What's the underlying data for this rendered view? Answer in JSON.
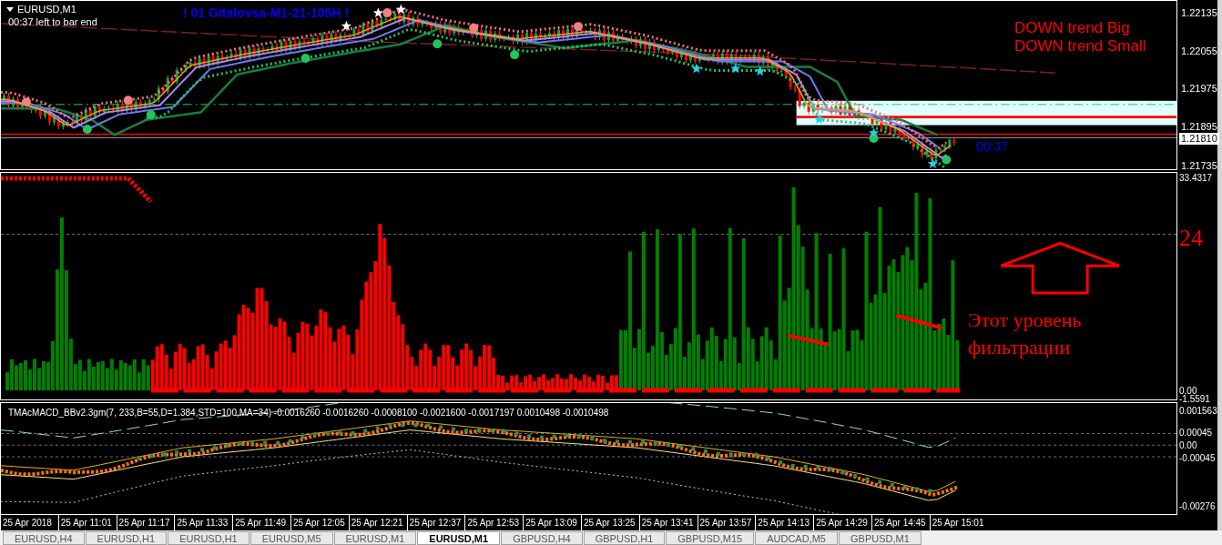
{
  "price_chart": {
    "symbol": "EURUSD,M1",
    "timer": "00:37 left to bar end",
    "banner": "! 01 Gitalovsa-M1-21-105H !",
    "trend_labels": [
      "DOWN trend Big",
      "DOWN trend Small"
    ],
    "countdown": "00:37",
    "axis": [
      {
        "label": "1.22135",
        "current": false
      },
      {
        "label": "1.22055",
        "current": false
      },
      {
        "label": "1.21975",
        "current": false
      },
      {
        "label": "1.21895",
        "current": false
      },
      {
        "label": "1.21810",
        "current": true
      },
      {
        "label": "1.21735",
        "current": false
      }
    ]
  },
  "histogram_panel": {
    "level_label": "24",
    "note": "Этот уровень фильтрации",
    "axis": [
      "33.4317",
      "0.00",
      "-1.5591"
    ]
  },
  "macd_panel": {
    "title": "TMAcMACD_BBv2.3gm(7, 233,B=55,D=1.384,STD=100,MA=34) -0.0016260 -0.0016260 -0.0008100 -0.0021600 -0.0017197 0.0010498 -0.0010498",
    "axis": [
      "0.001563",
      "0.00045",
      "0.00",
      "-0.00045",
      "-0.00276"
    ]
  },
  "time_axis": [
    "25 Apr 2018",
    "25 Apr 11:01",
    "25 Apr 11:17",
    "25 Apr 11:33",
    "25 Apr 11:49",
    "25 Apr 12:05",
    "25 Apr 12:21",
    "25 Apr 12:37",
    "25 Apr 12:53",
    "25 Apr 13:09",
    "25 Apr 13:25",
    "25 Apr 13:41",
    "25 Apr 13:57",
    "25 Apr 14:13",
    "25 Apr 14:29",
    "25 Apr 14:45",
    "25 Apr 15:01"
  ],
  "tabs": [
    {
      "label": "EURUSD,H4",
      "selected": false
    },
    {
      "label": "EURUSD,H1",
      "selected": false
    },
    {
      "label": "EURUSD,H1",
      "selected": false
    },
    {
      "label": "EURUSD,M5",
      "selected": false
    },
    {
      "label": "EURUSD,M1",
      "selected": false
    },
    {
      "label": "EURUSD,M1",
      "selected": true
    },
    {
      "label": "GBPUSD,H4",
      "selected": false
    },
    {
      "label": "GBPUSD,H1",
      "selected": false
    },
    {
      "label": "GBPUSD,M15",
      "selected": false
    },
    {
      "label": "AUDCAD,M5",
      "selected": false
    },
    {
      "label": "GBPUSD,M1",
      "selected": false
    }
  ]
}
